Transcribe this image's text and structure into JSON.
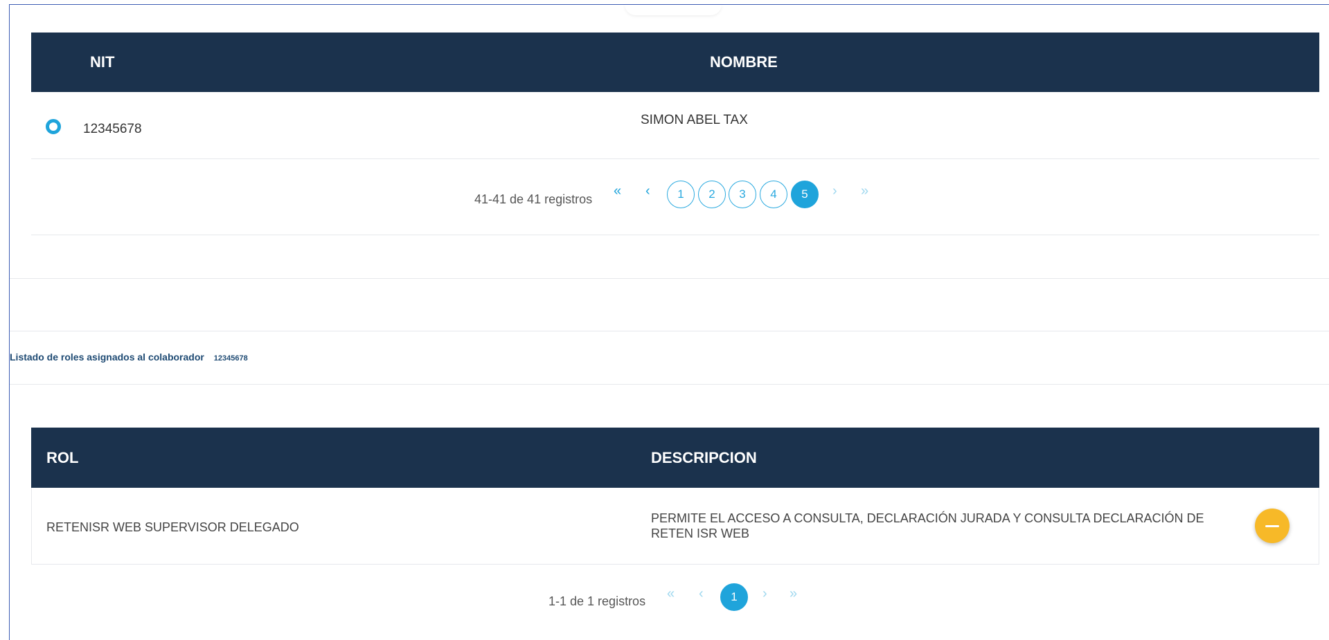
{
  "colaboradores_table": {
    "columns": [
      "NIT",
      "NOMBRE"
    ],
    "rows": [
      {
        "nit": "12345678",
        "nombre": "SIMON ABEL TAX",
        "selected": true
      }
    ],
    "pagination": {
      "info": "41-41 de 41 registros",
      "first": "«",
      "prev": "‹",
      "pages": [
        "1",
        "2",
        "3",
        "4",
        "5"
      ],
      "current": "5",
      "next": "›",
      "last": "»"
    }
  },
  "roles_section": {
    "caption": "Listado de roles asignados al colaborador",
    "nit": "12345678"
  },
  "roles_table": {
    "columns": [
      "ROL",
      "DESCRIPCION"
    ],
    "rows": [
      {
        "rol": "RETENISR WEB SUPERVISOR DELEGADO",
        "descripcion": "PERMITE EL ACCESO A CONSULTA, DECLARACIÓN JURADA Y CONSULTA DECLARACIÓN DE RETEN ISR WEB"
      }
    ],
    "pagination": {
      "info": "1-1 de 1 registros",
      "first": "«",
      "prev": "‹",
      "pages": [
        "1"
      ],
      "current": "1",
      "next": "›",
      "last": "»"
    }
  },
  "colors": {
    "header_bg": "#1b324d",
    "accent": "#1fa4db",
    "remove_button": "#f7b928"
  },
  "icons": {
    "remove": "minus-icon",
    "radio": "radio-selected-icon"
  }
}
